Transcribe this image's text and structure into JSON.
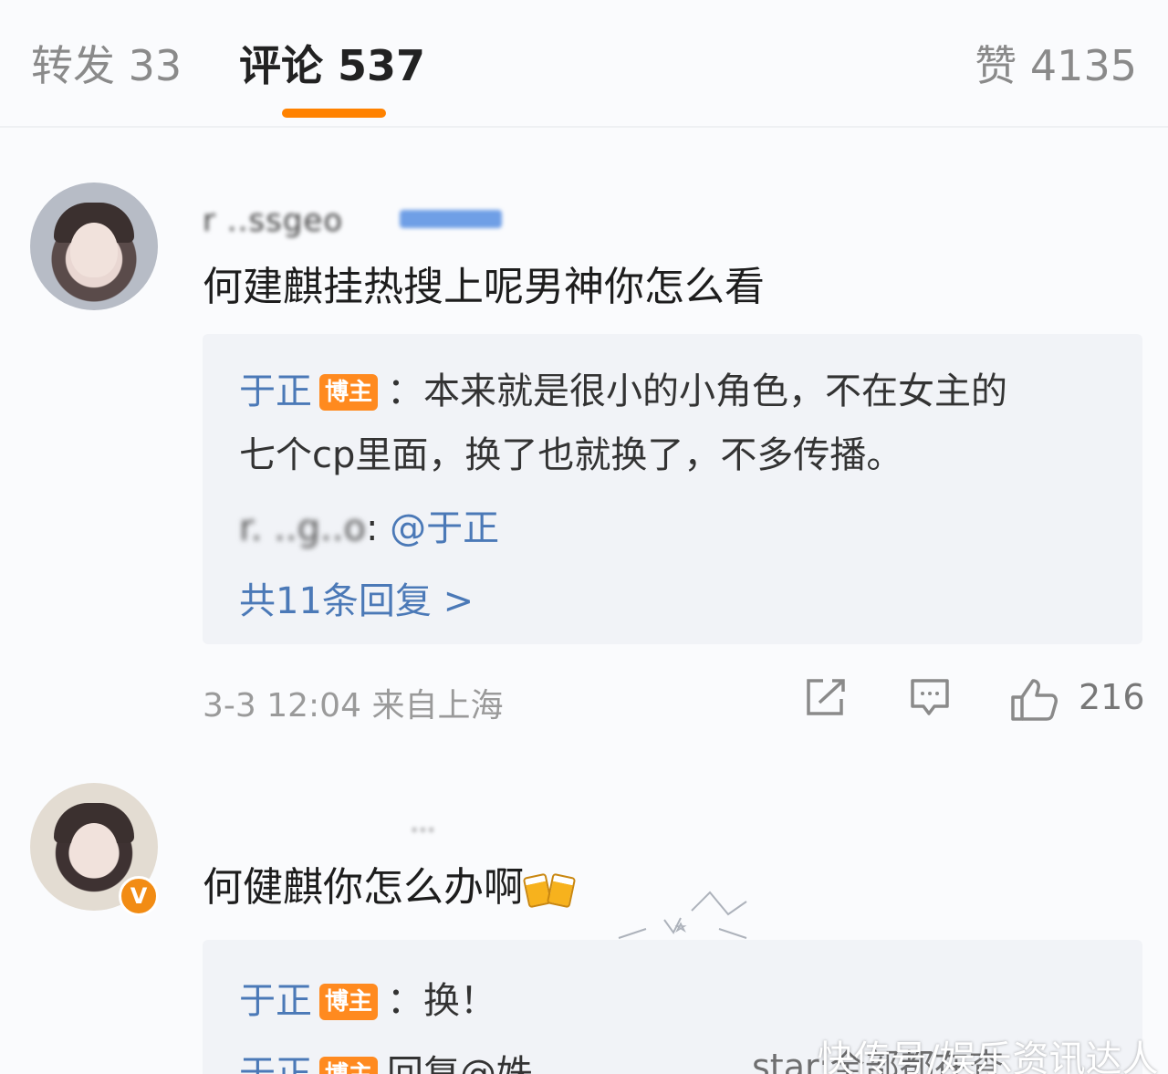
{
  "tabs": {
    "repost": "转发 33",
    "comment": "评论 537",
    "like": "赞 4135"
  },
  "comments": [
    {
      "username": "r ..ssgeo",
      "text": "何建麒挂热搜上呢男神你怎么看",
      "replies": [
        {
          "author": "于正",
          "badge": "博主",
          "text": "：本来就是很小的小角色，不在女主的"
        },
        {
          "text": "七个cp里面，换了也就换了，不多传播。"
        },
        {
          "author_blurred": "r.   ..g..o",
          "text": ": ",
          "mention": "@于正"
        }
      ],
      "more_replies": "共11条回复 >",
      "time": "3-3 12:04",
      "location": "来自上海",
      "likes": "216"
    },
    {
      "username": "...",
      "text": "何健麒你怎么办啊",
      "emoji": "beer-icon",
      "replies": [
        {
          "author": "于正",
          "badge": "博主",
          "text": "：换！"
        },
        {
          "author": "于正",
          "badge": "博主",
          "text": "回复@姝",
          "tail": "star:全部都在查"
        }
      ]
    }
  ],
  "watermark": "快传号/娱乐资讯达人",
  "colors": {
    "accent": "#ff8200",
    "link": "#4b79b7",
    "badge": "#ff8a1f",
    "reply_bg": "#f1f3f7"
  }
}
